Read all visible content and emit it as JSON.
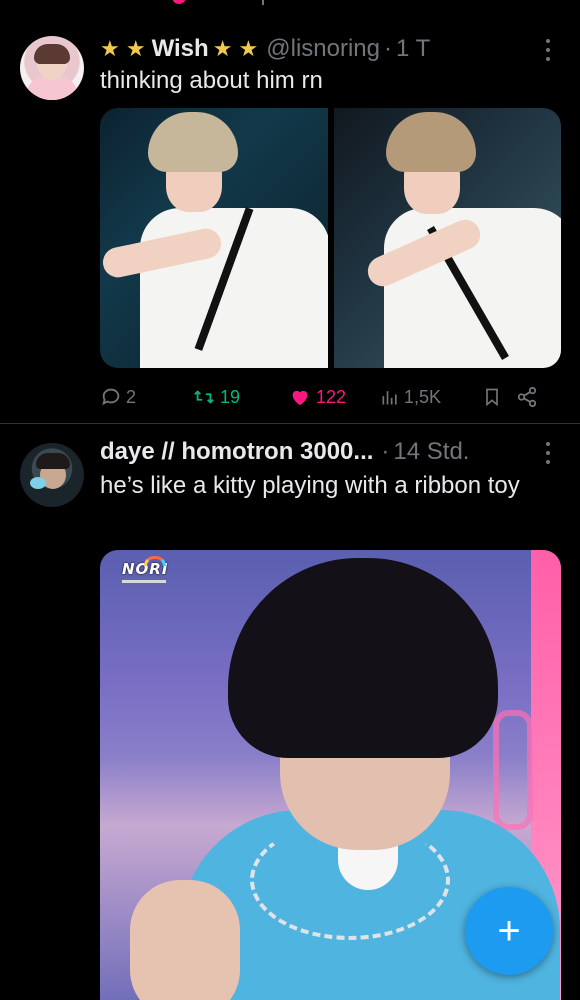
{
  "tweets": [
    {
      "author": {
        "prefix_stars": "★ ★",
        "name": "Wish",
        "suffix_stars": "★ ★",
        "handle": "@lisnoring",
        "separator": "·",
        "time": "1 T"
      },
      "text": "thinking about him rn",
      "media": {
        "type": "photo-grid",
        "count": 2
      },
      "actions": {
        "replies": "2",
        "retweets": "19",
        "likes": "122",
        "liked": true,
        "views": "1,5K"
      }
    },
    {
      "author": {
        "name": "daye // homotron 3000...",
        "separator": "·",
        "time": "14 Std."
      },
      "text": "he’s like a kitty playing with a ribbon toy",
      "media": {
        "type": "photo",
        "watermark": "NORI"
      }
    }
  ],
  "fab": {
    "label": "+",
    "icon": "plus-icon"
  },
  "colors": {
    "background": "#000000",
    "text": "#e7e9ea",
    "muted": "#71767b",
    "retweet": "#00ba7c",
    "like": "#f91880",
    "accent": "#1d9bf0",
    "star": "#f2c94c"
  }
}
